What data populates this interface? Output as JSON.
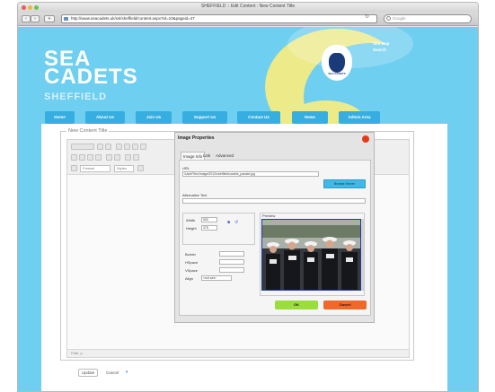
{
  "browser": {
    "title": "SHEFFIELD :: Edit Content : New Content Title",
    "url": "http://www.seacadets.uk/ssl/sheffield/content.aspx?id=10&pageid=47",
    "search_placeholder": "Google",
    "back_label": "‹",
    "forward_label": "›",
    "reload_label": "↻"
  },
  "site": {
    "brand_line1": "SEA",
    "brand_line2": "CADETS",
    "brand_sub": "SHEFFIELD",
    "crest_text": "SEA CADETS",
    "top_links": [
      "Site Map",
      "Search"
    ],
    "nav": [
      "Home",
      "About Us",
      "Join Us",
      "Support Us",
      "Contact Us",
      "News",
      "Admin Area"
    ]
  },
  "editor": {
    "legend": "New Content Title",
    "style_select": "Format",
    "font_select": "Styles",
    "path": "Path: p",
    "save_label": "Update",
    "cancel_label": "Cancel"
  },
  "dialog": {
    "title": "Image Properties",
    "tabs": [
      "Image Info",
      "Link",
      "Advanced"
    ],
    "url_label": "URL",
    "url_value": "/UserFiles/Image/2012/sheffield/cadets_parade.jpg",
    "browse_label": "Browse Server",
    "alt_label": "Alternative Text",
    "width_label": "Width",
    "width_value": "500",
    "height_label": "Height",
    "height_value": "375",
    "border_label": "Border",
    "hspace_label": "HSpace",
    "vspace_label": "VSpace",
    "align_label": "Align",
    "align_value": "<not set>",
    "preview_label": "Preview",
    "ok_label": "OK",
    "cancel_label": "Cancel"
  },
  "colors": {
    "site_bg": "#6ecff0",
    "accent_yellow": "#ecea89",
    "ok_green": "#9bdd3a",
    "cancel_orange": "#f0692a",
    "close_red": "#e53a17"
  }
}
